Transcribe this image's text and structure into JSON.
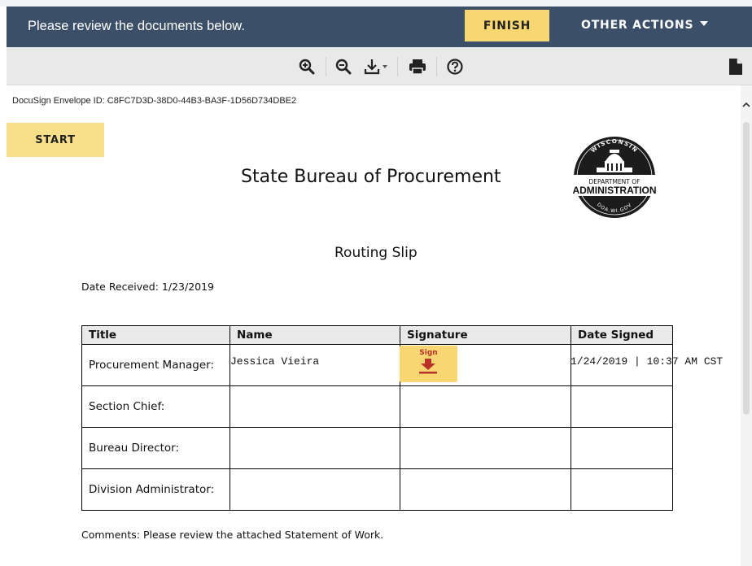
{
  "header": {
    "message": "Please review the documents below.",
    "finish_label": "FINISH",
    "other_actions_label": "OTHER ACTIONS"
  },
  "toolbar": {
    "icons": [
      "zoom-in-icon",
      "zoom-out-icon",
      "download-icon",
      "print-icon",
      "help-icon",
      "document-icon"
    ]
  },
  "envelope_id": "DocuSign Envelope ID: C8FC7D3D-38D0-44B3-BA3F-1D56D734DBE2",
  "start_label": "START",
  "document": {
    "title": "State Bureau of Procurement",
    "seal": {
      "top_text": "WISCONSIN",
      "line1": "DEPARTMENT OF",
      "line2": "ADMINISTRATION",
      "bottom_text": "DOA.WI.GOV"
    },
    "subtitle": "Routing Slip",
    "date_received": "Date Received: 1/23/2019",
    "table": {
      "headers": [
        "Title",
        "Name",
        "Signature",
        "Date Signed"
      ],
      "rows": [
        {
          "title": "Procurement Manager:",
          "name": "Jessica Vieira",
          "signature": "",
          "date": "1/24/2019 | 10:37 AM CST"
        },
        {
          "title": "Section Chief:",
          "name": "",
          "signature": "",
          "date": ""
        },
        {
          "title": "Bureau Director:",
          "name": "",
          "signature": "",
          "date": ""
        },
        {
          "title": "Division Administrator:",
          "name": "",
          "signature": "",
          "date": ""
        }
      ]
    },
    "sign_tab_label": "Sign",
    "comments": "Comments: Please review the attached Statement of Work."
  },
  "colors": {
    "header_bg": "#3b5068",
    "button_yellow": "#f8d671",
    "sign_red": "#b8322a"
  }
}
